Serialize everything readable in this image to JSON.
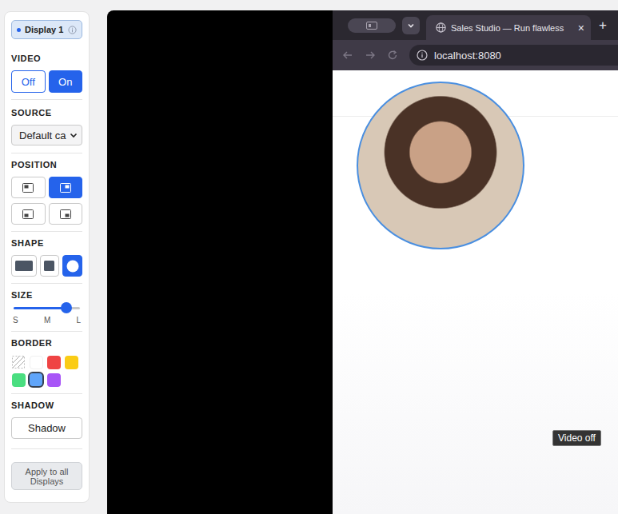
{
  "sidebar": {
    "display": {
      "label": "Display 1"
    },
    "video": {
      "label": "VIDEO",
      "options": [
        {
          "label": "Off",
          "selected": false
        },
        {
          "label": "On",
          "selected": true
        }
      ]
    },
    "source": {
      "label": "SOURCE",
      "value": "Default ca"
    },
    "position": {
      "label": "POSITION",
      "options": [
        {
          "selected": false
        },
        {
          "selected": true
        },
        {
          "selected": false
        },
        {
          "selected": false
        }
      ]
    },
    "shape": {
      "label": "SHAPE",
      "options": [
        {
          "kind": "rectangle",
          "selected": false
        },
        {
          "kind": "square",
          "selected": false
        },
        {
          "kind": "circle",
          "selected": true
        }
      ]
    },
    "size": {
      "label": "SIZE",
      "level": 0.8,
      "ticks": [
        "S",
        "M",
        "L"
      ]
    },
    "border": {
      "label": "BORDER",
      "swatches": [
        {
          "kind": "none",
          "selected": false
        },
        {
          "kind": "color",
          "color": "#ffffff",
          "selected": false
        },
        {
          "kind": "color",
          "color": "#ef4444",
          "selected": false
        },
        {
          "kind": "color",
          "color": "#facc15",
          "selected": false
        },
        {
          "kind": "color",
          "color": "#4ade80",
          "selected": false
        },
        {
          "kind": "color",
          "color": "#60a5fa",
          "selected": true
        },
        {
          "kind": "color",
          "color": "#a855f7",
          "selected": false
        }
      ]
    },
    "shadow": {
      "label": "SHADOW",
      "button": {
        "label": "Shadow",
        "on": false
      }
    },
    "apply_button": {
      "label": "Apply to all Displays"
    }
  },
  "preview": {
    "browser": {
      "tab_title": "Sales Studio — Run flawless",
      "tab_close": "×",
      "new_tab": "+",
      "url": "localhost:8080"
    },
    "tooltip": "Video off"
  }
}
